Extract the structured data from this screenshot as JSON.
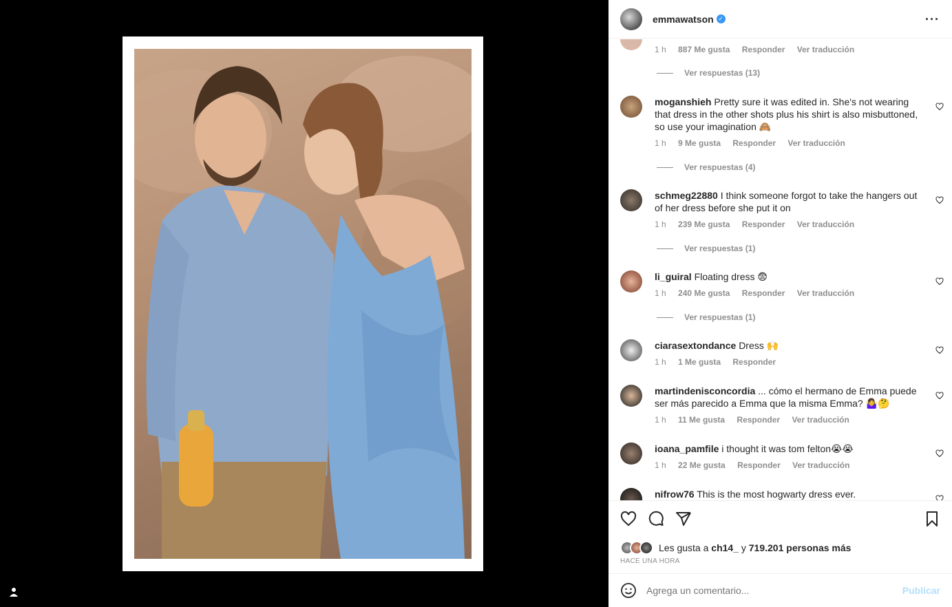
{
  "post": {
    "username": "emmawatson",
    "more_icon": "more-horizontal-icon"
  },
  "comments": [
    {
      "id": "c0",
      "user": "",
      "text": "",
      "time": "1 h",
      "likes": "887 Me gusta",
      "reply": "Responder",
      "translate": "Ver traducción",
      "replies": "Ver respuestas (13)"
    },
    {
      "id": "c1",
      "user": "moganshieh",
      "text": "Pretty sure it was edited in. She's not wearing that dress in the other shots plus his shirt is also misbuttoned, so use your imagination 🙈",
      "time": "1 h",
      "likes": "9 Me gusta",
      "reply": "Responder",
      "translate": "Ver traducción",
      "replies": "Ver respuestas (4)"
    },
    {
      "id": "c2",
      "user": "schmeg22880",
      "text": "I think someone forgot to take the hangers out of her dress before she put it on",
      "time": "1 h",
      "likes": "239 Me gusta",
      "reply": "Responder",
      "translate": "Ver traducción",
      "replies": "Ver respuestas (1)"
    },
    {
      "id": "c3",
      "user": "li_guiral",
      "text": "Floating dress 😨",
      "time": "1 h",
      "likes": "240 Me gusta",
      "reply": "Responder",
      "translate": "Ver traducción",
      "replies": "Ver respuestas (1)"
    },
    {
      "id": "c4",
      "user": "ciarasextondance",
      "text": "Dress 🙌",
      "time": "1 h",
      "likes": "1 Me gusta",
      "reply": "Responder",
      "translate": "",
      "replies": ""
    },
    {
      "id": "c5",
      "user": "martindenisconcordia",
      "text": "... cómo el hermano de Emma puede ser más parecido a Emma que la misma Emma? 🤷‍♀️🤔",
      "time": "1 h",
      "likes": "11 Me gusta",
      "reply": "Responder",
      "translate": "Ver traducción",
      "replies": ""
    },
    {
      "id": "c6",
      "user": "ioana_pamfile",
      "text": "i thought it was tom felton😭😭",
      "time": "1 h",
      "likes": "22 Me gusta",
      "reply": "Responder",
      "translate": "Ver traducción",
      "replies": ""
    },
    {
      "id": "c7",
      "user": "nifrow76",
      "text": "This is the most hogwarty dress ever.",
      "time": "",
      "likes": "",
      "reply": "",
      "translate": "",
      "replies": ""
    }
  ],
  "likes": {
    "prefix": "Les gusta a",
    "user": "ch14_",
    "middle": "y",
    "count": "719.201 personas más"
  },
  "timestamp": "HACE UNA HORA",
  "comment_box": {
    "placeholder": "Agrega un comentario...",
    "publish": "Publicar"
  },
  "colors": {
    "verified": "#3897f0",
    "publish_disabled": "#b2dffc",
    "meta_gray": "#8e8e8e"
  }
}
